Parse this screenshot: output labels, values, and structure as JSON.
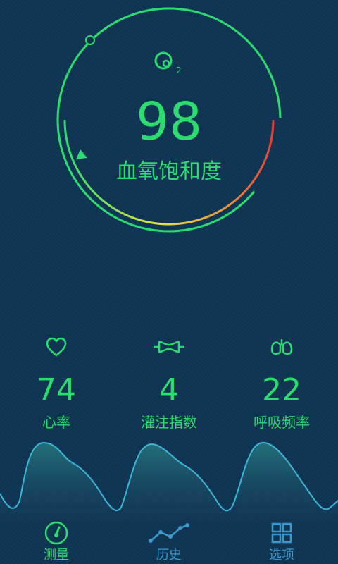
{
  "gauge": {
    "o2_symbol": "O",
    "o2_subscript": "2",
    "value": "98",
    "label": "血氧饱和度",
    "colors": {
      "ring": "#2bdc6e",
      "track": "#1e5f86",
      "gradient": [
        "#2bdc6e",
        "#f2e04a",
        "#e84b3c"
      ]
    }
  },
  "metrics": [
    {
      "icon": "heart-icon",
      "value": "74",
      "label": "心率"
    },
    {
      "icon": "perfusion-icon",
      "value": "4",
      "label": "灌注指数"
    },
    {
      "icon": "lungs-icon",
      "value": "22",
      "label": "呼吸频率"
    }
  ],
  "tabs": [
    {
      "icon": "gauge-icon",
      "label": "测量",
      "active": true
    },
    {
      "icon": "history-chart-icon",
      "label": "历史",
      "active": false
    },
    {
      "icon": "grid-icon",
      "label": "选项",
      "active": false
    }
  ],
  "colors": {
    "background": "#0f3452",
    "accent": "#2bdc6e",
    "wave": "#3ab8d8",
    "inactive_tab": "#3a9ad0"
  }
}
